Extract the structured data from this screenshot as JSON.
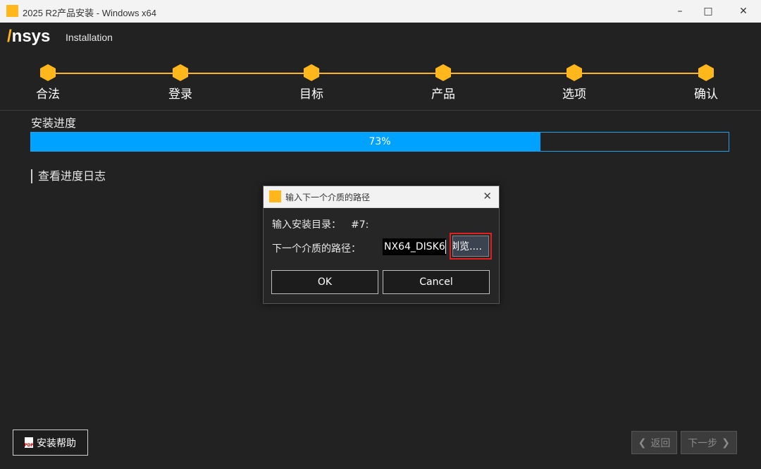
{
  "window": {
    "title": "2025 R2产品安装 - Windows x64"
  },
  "window_controls": {
    "minimize": "–",
    "maximize": "□",
    "close": "✕"
  },
  "header": {
    "logo_a": "/",
    "logo_text": "nsys",
    "subtitle": "Installation",
    "brand_color": "#ffb71b"
  },
  "steps": [
    {
      "label": "合法"
    },
    {
      "label": "登录"
    },
    {
      "label": "目标"
    },
    {
      "label": "产品"
    },
    {
      "label": "选项"
    },
    {
      "label": "确认"
    }
  ],
  "progress": {
    "title": "安装进度",
    "value": 73,
    "text": "73%",
    "fill_color": "#00a2ff"
  },
  "log_link": "查看进度日志",
  "dialog": {
    "title": "输入下一个介质的路径",
    "close": "✕",
    "install_dir_label": "输入安装目录：",
    "install_dir_value": "#7:",
    "path_label": "下一个介质的路径：",
    "path_value": "NX64_DISK6",
    "browse_label": "浏览....",
    "ok_label": "OK",
    "cancel_label": "Cancel"
  },
  "footer": {
    "help_icon_text": "PDF",
    "help_label": "安装帮助",
    "back_label": "返回",
    "next_label": "下一步",
    "back_icon": "❮",
    "next_icon": "❯"
  }
}
